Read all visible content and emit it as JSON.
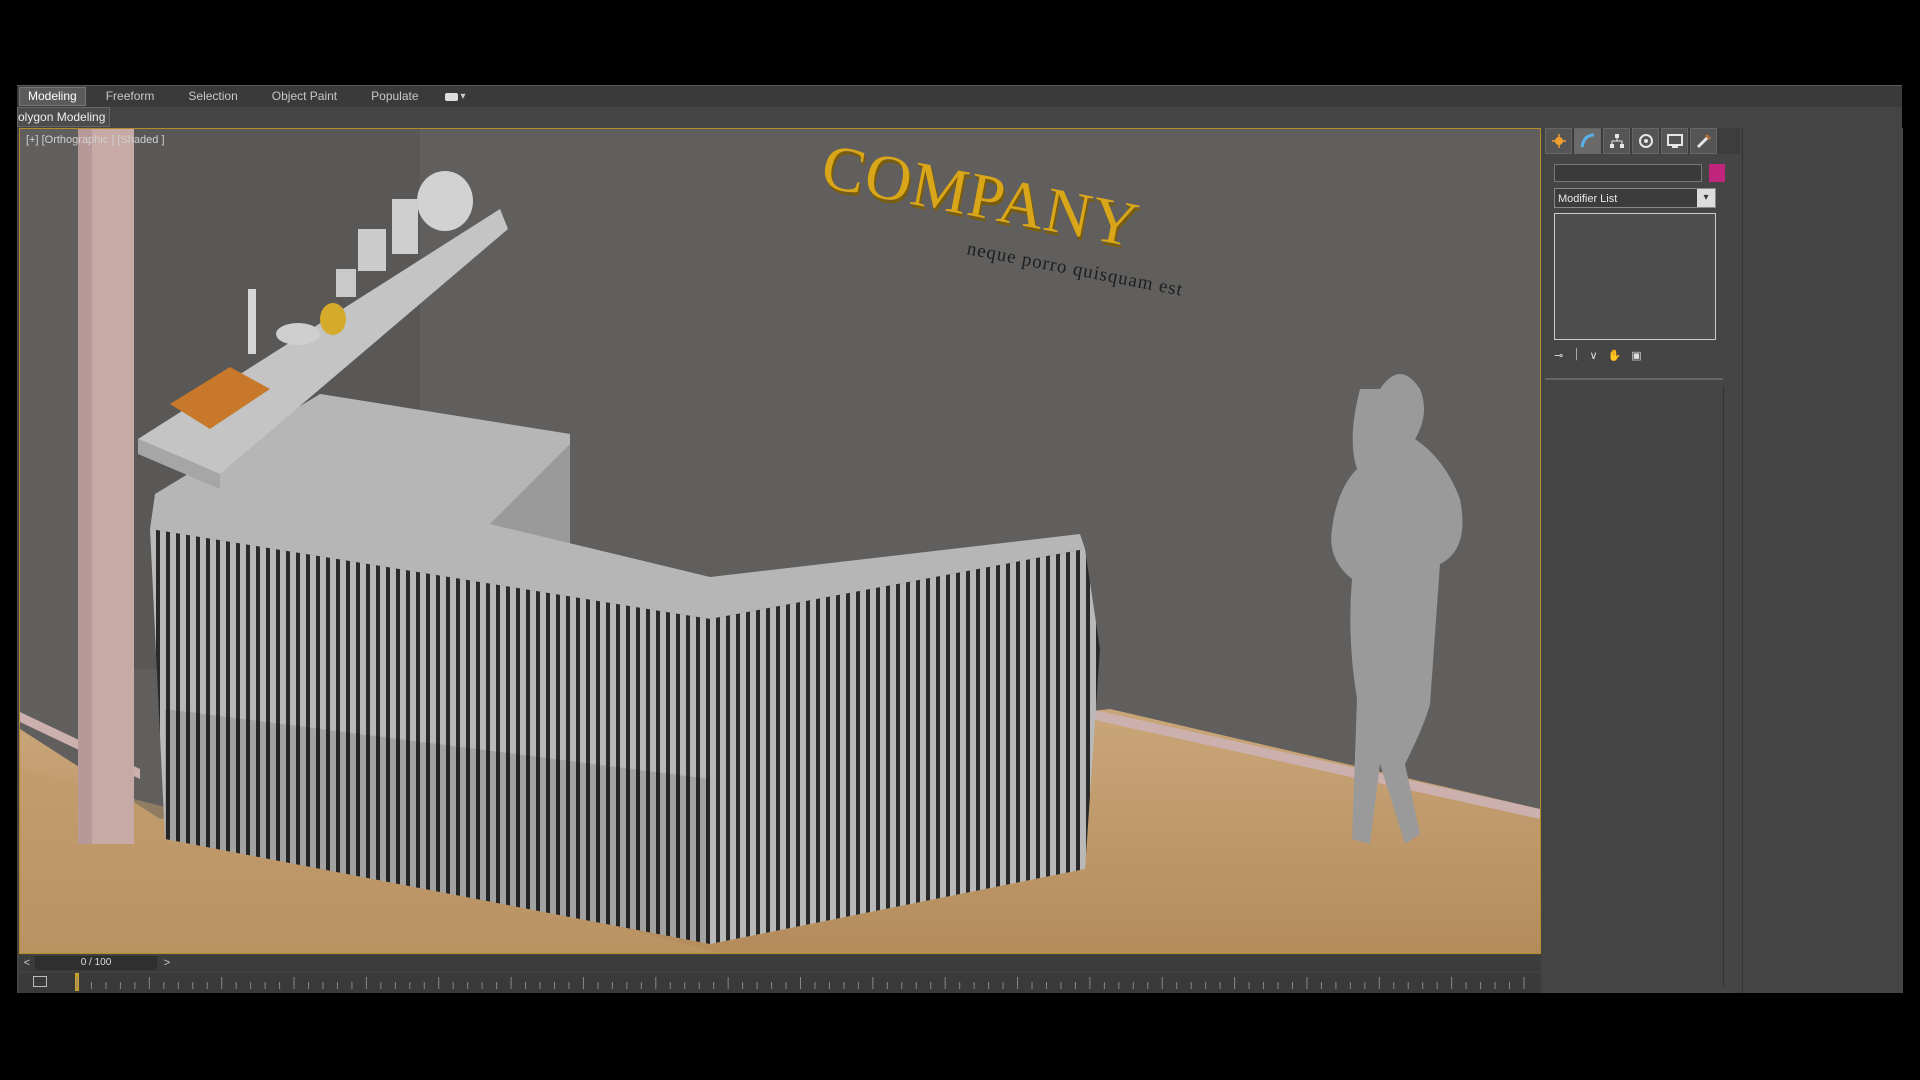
{
  "ribbon": {
    "tabs": [
      "Modeling",
      "Freeform",
      "Selection",
      "Object Paint",
      "Populate"
    ],
    "active_tab": "Modeling",
    "subpanel_label": "olygon Modeling"
  },
  "viewport": {
    "label": "[+] [Orthographic ] [Shaded ]",
    "sign_title": "COMPANY",
    "sign_tagline": "neque porro quisquam est"
  },
  "timeline": {
    "prev_label": "<",
    "next_label": ">",
    "frame_display": "0 / 100",
    "current_frame": 0,
    "total_frames": 100
  },
  "command_panel": {
    "tabs": [
      "create-icon",
      "modify-icon",
      "hierarchy-icon",
      "motion-icon",
      "display-icon",
      "utilities-icon"
    ],
    "active_tab": "modify-icon",
    "object_color": "#c0257b",
    "modifier_list_label": "Modifier List",
    "stack_tools": [
      "pin-icon",
      "show-end-result-icon",
      "make-unique-icon",
      "remove-modifier-icon",
      "configure-icon"
    ]
  },
  "colors": {
    "accent_gold": "#d9a519",
    "viewport_border": "#b48c2a"
  }
}
